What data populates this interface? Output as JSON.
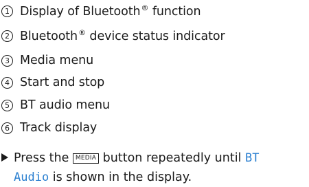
{
  "legend": {
    "items": [
      {
        "number": "1",
        "text": "Display of Bluetooth",
        "superscript": "®",
        "suffix": " function"
      },
      {
        "number": "2",
        "text": "Bluetooth",
        "superscript": "®",
        "suffix": " device status indicator"
      },
      {
        "number": "3",
        "text": "Media menu"
      },
      {
        "number": "4",
        "text": "Start and stop"
      },
      {
        "number": "5",
        "text": "BT audio menu"
      },
      {
        "number": "6",
        "text": "Track display"
      }
    ]
  },
  "instruction": {
    "prefix": "Press the ",
    "button_key": "MEDIA",
    "middle": " button repeatedly until ",
    "display_text_line1": "BT",
    "display_text_line2": "Audio",
    "suffix": " is shown in the display."
  },
  "colors": {
    "text": "#1a1a1a",
    "display_text": "#2a7fd0"
  }
}
